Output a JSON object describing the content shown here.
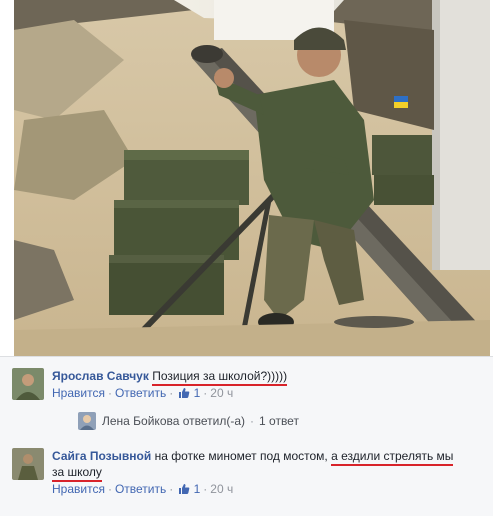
{
  "photo": {
    "icon": "photo-mortar-soldier"
  },
  "comments": [
    {
      "author": "Ярослав Савчук",
      "text": "Позиция за школой?)))))",
      "actions": {
        "like": "Нравится",
        "reply": "Ответить",
        "like_count": "1",
        "time": "20 ч"
      }
    },
    {
      "author": "Сайга Позывной",
      "text_plain": "на фотке миномет под мостом,",
      "text_underlined_1": "а ездили стрелять мы",
      "text_underlined_2": "за школу",
      "actions": {
        "like": "Нравится",
        "reply": "Ответить",
        "like_count": "1",
        "time": "20 ч"
      }
    }
  ],
  "reply_summary": {
    "name": "Лена Бойкова ответил(-а)",
    "dot": "·",
    "count": "1 ответ"
  },
  "separator": "·",
  "colors": {
    "link": "#4267b2",
    "author": "#365899",
    "underline": "#d8232a",
    "muted": "#90949c"
  }
}
